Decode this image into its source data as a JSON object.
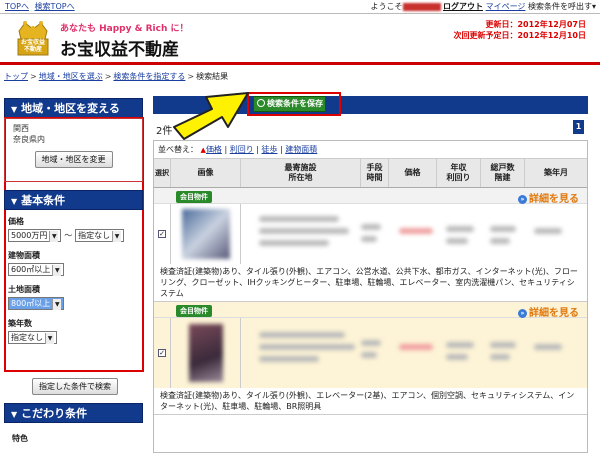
{
  "topbar": {
    "left_links": [
      "TOPへ",
      "検索TOPへ"
    ],
    "welcome": "ようこそ",
    "logout": "ログアウト",
    "mypage": "マイページ",
    "load_conditions": "検索条件を呼出す▾"
  },
  "header": {
    "logo_label": "お宝収益\n不動産",
    "tagline": "あなたも Happy & Rich に！",
    "brand": "お宝収益不動産",
    "updated": "更新日：2012年12月07日",
    "next_update": "次回更新予定日：2012年12月10日"
  },
  "breadcrumb": {
    "items": [
      "トップ",
      "地域・地区を選ぶ",
      "検索条件を指定する",
      "検索結果"
    ],
    "sep": ">"
  },
  "sidebar": {
    "area_heading": "地域・地区を変える",
    "area_lines": [
      "関西",
      "奈良県内"
    ],
    "change_area_button": "地域・地区を変更",
    "basic_heading": "基本条件",
    "price_label": "価格",
    "price_min": "5000万円",
    "price_sep": "〜",
    "price_max": "指定なし",
    "building_area_label": "建物面積",
    "building_area_value": "600㎡以上",
    "land_area_label": "土地面積",
    "land_area_value": "800㎡以上",
    "age_label": "築年数",
    "age_value": "指定なし",
    "search_button": "指定した条件で検索",
    "kodawari_heading": "こだわり条件",
    "tokushoku_label": "特色"
  },
  "main": {
    "save_button": "検索条件を保存",
    "count_text": "2件",
    "page_number": "1",
    "sort_label": "並べ替え：",
    "sort_links": [
      "価格",
      "利回り",
      "徒歩",
      "建物面積"
    ],
    "columns": [
      "選択",
      "画像",
      "最寄施設\n所在地",
      "手段\n時間",
      "価格",
      "年収\n利回り",
      "総戸数\n階建",
      "築年月"
    ],
    "records": [
      {
        "badge": "会目物件",
        "detail": "詳細を見る",
        "checked": "✓",
        "features": "検査済証(建築物)あり、タイル張り(外観)、エアコン、公営水道、公共下水、都市ガス、インターネット(光)、フローリング、クローゼット、IHクッキングヒーター、駐車場、駐輪場、エレベーター、室内洗濯機パン、セキュリティシステム"
      },
      {
        "badge": "会目物件",
        "detail": "詳細を見る",
        "checked": "✓",
        "features": "検査済証(建築物)あり、タイル張り(外観)、エレベーター(2基)、エアコン、個別空調、セキュリティシステム、インターネット(光)、駐車場、駐輪場、BR照明具"
      }
    ]
  },
  "colors": {
    "navy": "#123a8c",
    "red": "#d00000",
    "green": "#2a8a2a",
    "orange": "#e07a10",
    "highlight_row": "#fdf3d6"
  }
}
